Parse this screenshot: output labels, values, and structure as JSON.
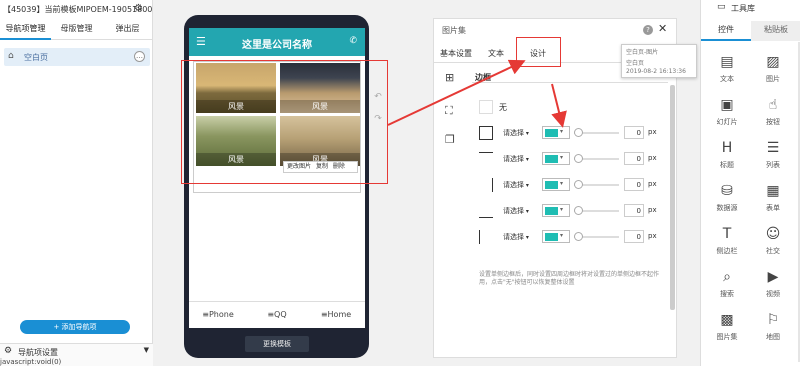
{
  "left_panel": {
    "title": "【45039】当前模板MIPOEM-19051800",
    "tabs": [
      "导航项管理",
      "母版管理",
      "弹出层"
    ],
    "nav_item": "空白页",
    "add_button": "+ 添加导航项",
    "settings_label": "导航项设置",
    "status_text": "javascript:void(0)"
  },
  "phone": {
    "site_title": "这里是公司名称",
    "images": [
      {
        "caption": "风景"
      },
      {
        "caption": "风景"
      },
      {
        "caption": "风景"
      },
      {
        "caption": "风景"
      }
    ],
    "context_actions": [
      "更改图片",
      "复制",
      "删除"
    ],
    "nav": [
      "Phone",
      "QQ",
      "Home"
    ],
    "change_template": "更换模板"
  },
  "dialog": {
    "title": "图片集",
    "tabs": [
      "基本设置",
      "文本",
      "设计"
    ],
    "active_tab": "设计",
    "section": "边框",
    "none_label": "无",
    "rows": [
      {
        "select": "请选择",
        "color": "#1fbdb3",
        "value": "0",
        "unit": "px"
      },
      {
        "select": "请选择",
        "color": "#1fbdb3",
        "value": "0",
        "unit": "px"
      },
      {
        "select": "请选择",
        "color": "#1fbdb3",
        "value": "0",
        "unit": "px"
      },
      {
        "select": "请选择",
        "color": "#1fbdb3",
        "value": "0",
        "unit": "px"
      },
      {
        "select": "请选择",
        "color": "#1fbdb3",
        "value": "0",
        "unit": "px"
      }
    ],
    "note": "设置单侧边框后，同时设置四周边框时将对设置过的单侧边框不起作用，点击\"无\"按钮可以恢复整体设置"
  },
  "tooltip": {
    "line1": "空白页-图片",
    "line2": "空白页",
    "line3": "2019-08-2 16:13:36"
  },
  "right_panel": {
    "title": "工具库",
    "tabs": [
      "控件",
      "粘贴板"
    ],
    "items": [
      {
        "label": "文本",
        "icon": "text-icon"
      },
      {
        "label": "图片",
        "icon": "image-icon"
      },
      {
        "label": "幻灯片",
        "icon": "slideshow-icon"
      },
      {
        "label": "按钮",
        "icon": "button-icon"
      },
      {
        "label": "标题",
        "icon": "heading-icon"
      },
      {
        "label": "列表",
        "icon": "list-icon"
      },
      {
        "label": "数据源",
        "icon": "database-icon"
      },
      {
        "label": "表单",
        "icon": "form-icon"
      },
      {
        "label": "侧边栏",
        "icon": "sidebar-icon"
      },
      {
        "label": "社交",
        "icon": "social-icon"
      },
      {
        "label": "搜索",
        "icon": "search-icon"
      },
      {
        "label": "视频",
        "icon": "video-icon"
      },
      {
        "label": "图片集",
        "icon": "gallery-icon"
      },
      {
        "label": "地图",
        "icon": "map-icon"
      }
    ]
  },
  "colors": {
    "accent": "#1a8fd4",
    "header": "#23a6b0",
    "highlight": "#e53935"
  }
}
